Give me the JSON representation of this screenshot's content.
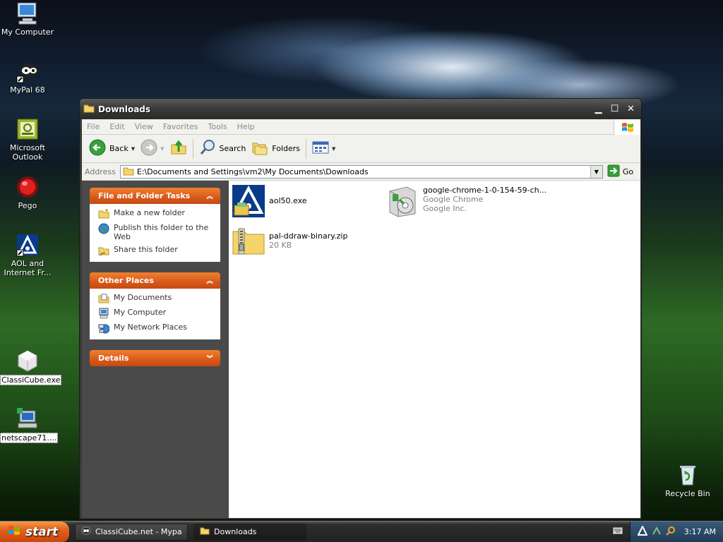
{
  "desktop": {
    "icons": [
      {
        "label": "My Computer",
        "icon": "my-computer-icon"
      },
      {
        "label": "MyPal 68",
        "icon": "mypal-icon"
      },
      {
        "label": "Microsoft Outlook",
        "icon": "outlook-icon"
      },
      {
        "label": "Pego",
        "icon": "pego-icon"
      },
      {
        "label": "AOL and Internet Fr...",
        "icon": "aol-icon"
      },
      {
        "label": "ClassiCube.exe",
        "icon": "classicube-icon"
      },
      {
        "label": "netscape71....",
        "icon": "netscape-icon"
      },
      {
        "label": "Recycle Bin",
        "icon": "recycle-bin-icon"
      }
    ]
  },
  "window": {
    "title": "Downloads",
    "menu": [
      "File",
      "Edit",
      "View",
      "Favorites",
      "Tools",
      "Help"
    ],
    "toolbar": {
      "back": "Back",
      "search": "Search",
      "folders": "Folders"
    },
    "address": {
      "label": "Address",
      "value": "E:\\Documents and Settings\\vm2\\My Documents\\Downloads",
      "go": "Go"
    },
    "left_pane": {
      "file_tasks": {
        "title": "File and Folder Tasks",
        "items": [
          "Make a new folder",
          "Publish this folder to the Web",
          "Share this folder"
        ]
      },
      "other_places": {
        "title": "Other Places",
        "items": [
          "My Documents",
          "My Computer",
          "My Network Places"
        ]
      },
      "details": {
        "title": "Details"
      }
    },
    "files": [
      {
        "name": "aol50.exe",
        "meta1": "",
        "meta2": ""
      },
      {
        "name": "google-chrome-1-0-154-59-ch...",
        "meta1": "Google Chrome",
        "meta2": "Google Inc."
      },
      {
        "name": "pal-ddraw-binary.zip",
        "meta1": "20 KB",
        "meta2": ""
      }
    ]
  },
  "taskbar": {
    "start": "start",
    "tasks": [
      {
        "label": "ClassiCube.net - Mypal"
      },
      {
        "label": "Downloads"
      }
    ],
    "clock": "3:17 AM"
  },
  "colors": {
    "panel_header": "#d8581a",
    "start_button": "#e0601c",
    "window_frame": "#3a3a3a"
  }
}
